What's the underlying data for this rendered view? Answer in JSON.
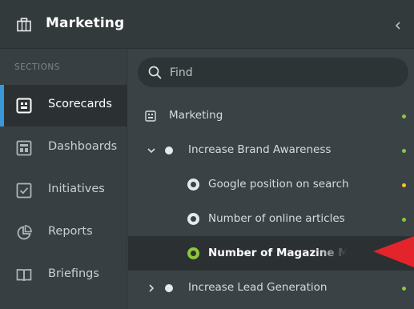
{
  "header": {
    "title": "Marketing"
  },
  "sidebar": {
    "sections_label": "SECTIONS",
    "items": [
      {
        "label": "Scorecards",
        "icon": "scorecard-icon",
        "active": true
      },
      {
        "label": "Dashboards",
        "icon": "dashboard-icon",
        "active": false
      },
      {
        "label": "Initiatives",
        "icon": "checkbox-icon",
        "active": false
      },
      {
        "label": "Reports",
        "icon": "pie-chart-icon",
        "active": false
      },
      {
        "label": "Briefings",
        "icon": "book-icon",
        "active": false
      }
    ]
  },
  "search": {
    "placeholder": "Find"
  },
  "tree": {
    "rows": [
      {
        "label": "Marketing",
        "type": "scorecard",
        "status": "green"
      },
      {
        "label": "Increase Brand Awareness",
        "type": "objective",
        "expanded": true,
        "status": "green"
      },
      {
        "label": "Google position on search",
        "type": "kpi",
        "status": "yellow"
      },
      {
        "label": "Number of online articles",
        "type": "kpi",
        "status": "green"
      },
      {
        "label": "Number of Magazine Mentions",
        "type": "kpi",
        "selected": true,
        "status": "green"
      },
      {
        "label": "Increase Lead Generation",
        "type": "objective",
        "expanded": false,
        "status": "green"
      }
    ]
  },
  "colors": {
    "accent": "#3a98d8",
    "status_green": "#8dc63f",
    "status_yellow": "#f2c230",
    "selected_kpi_ring": "#8dc63f",
    "annotation_arrow": "#e4242b"
  }
}
